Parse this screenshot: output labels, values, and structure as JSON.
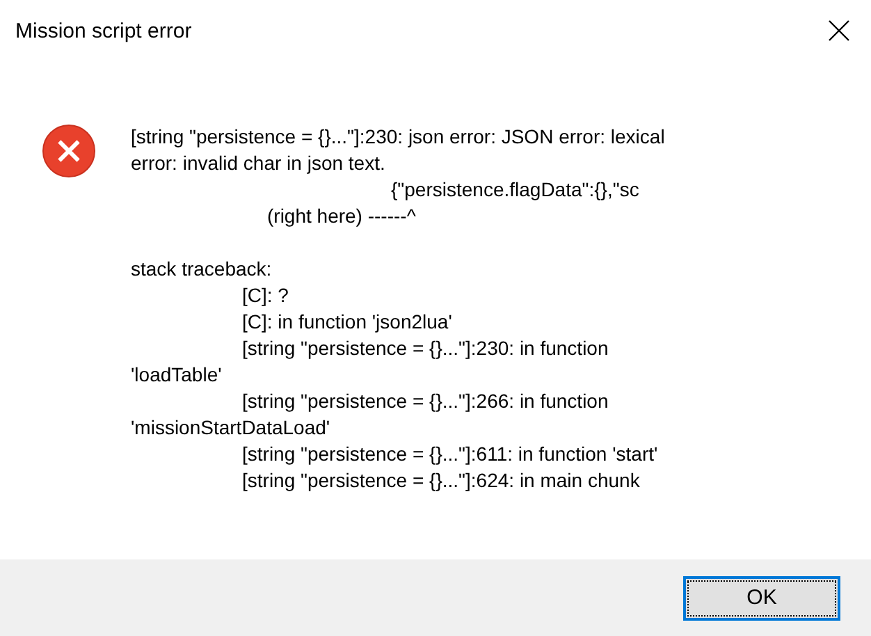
{
  "window": {
    "title": "Mission script error"
  },
  "message": [
    {
      "kind": "flush",
      "text": "[string \"persistence = {}...\"]:230: json error: JSON error: lexical"
    },
    {
      "kind": "flush",
      "text": "error: invalid char in json text."
    },
    {
      "kind": "snippet",
      "text": "{\"persistence.flagData\":{},\"sc"
    },
    {
      "kind": "pointer",
      "text": "(right here) ------^"
    },
    {
      "kind": "blank"
    },
    {
      "kind": "flush",
      "text": "stack traceback:"
    },
    {
      "kind": "frame",
      "text": "[C]: ?"
    },
    {
      "kind": "frame",
      "text": "[C]: in function 'json2lua'"
    },
    {
      "kind": "frame",
      "text": "[string \"persistence = {}...\"]:230: in function"
    },
    {
      "kind": "flush",
      "text": "'loadTable'"
    },
    {
      "kind": "frame",
      "text": "[string \"persistence = {}...\"]:266: in function"
    },
    {
      "kind": "flush",
      "text": "'missionStartDataLoad'"
    },
    {
      "kind": "frame",
      "text": "[string \"persistence = {}...\"]:611: in function 'start'"
    },
    {
      "kind": "frame",
      "text": "[string \"persistence = {}...\"]:624: in main chunk"
    }
  ],
  "buttons": [
    {
      "label": "OK",
      "selected": true
    }
  ]
}
